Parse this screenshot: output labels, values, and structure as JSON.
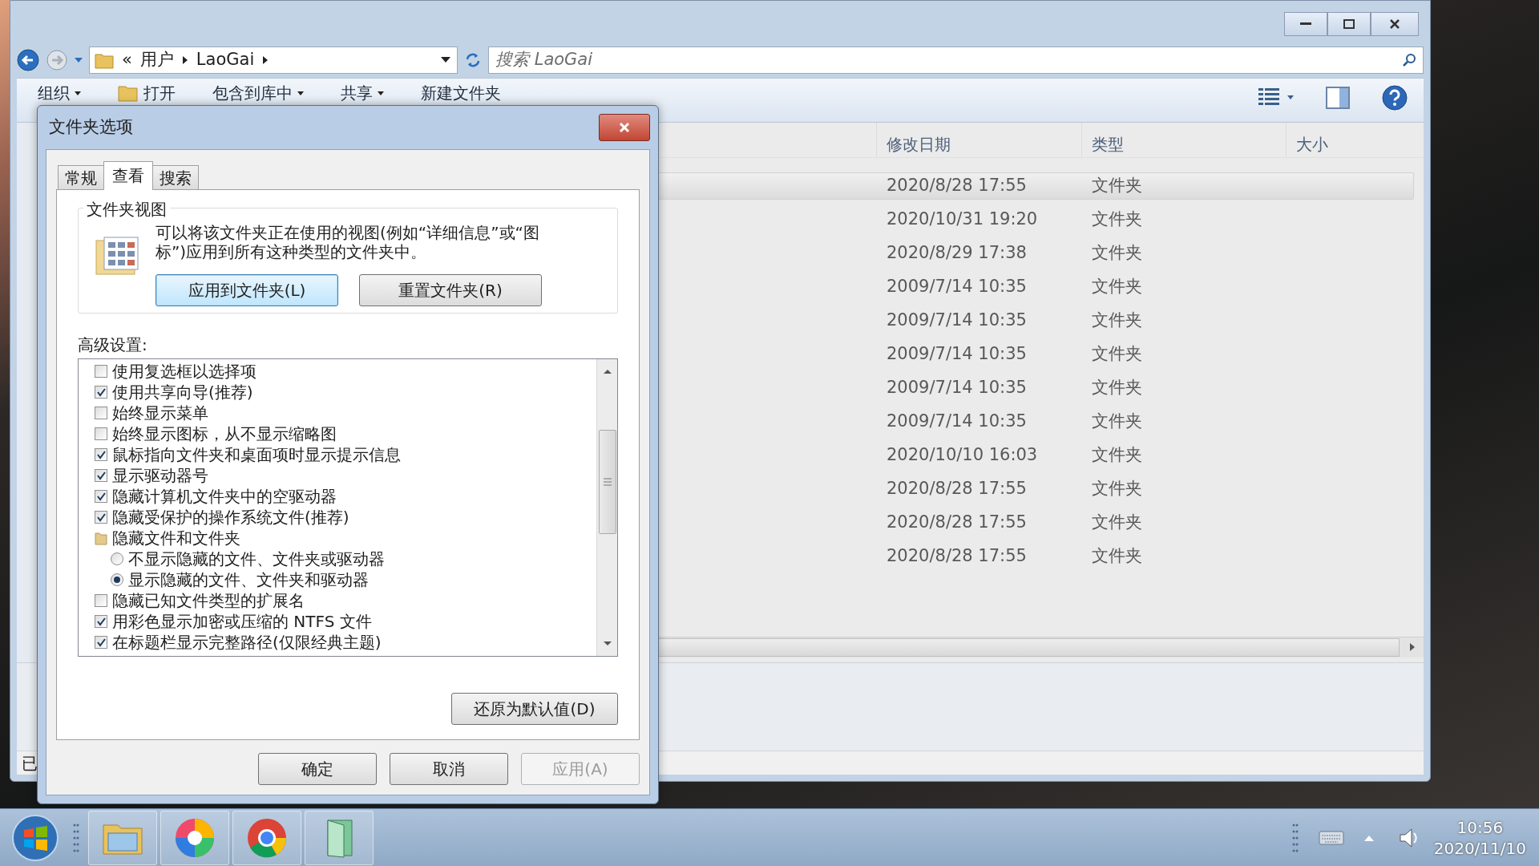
{
  "explorer": {
    "address": {
      "overflow_mark": "«",
      "path": [
        "用户",
        "LaoGai"
      ]
    },
    "search": {
      "placeholder": "搜索 LaoGai"
    },
    "toolbar": [
      {
        "label": "组织",
        "kind": "menu"
      },
      {
        "label": "打开",
        "kind": "open"
      },
      {
        "label": "包含到库中",
        "kind": "menu"
      },
      {
        "label": "共享",
        "kind": "menu"
      },
      {
        "label": "新建文件夹",
        "kind": "plain"
      }
    ],
    "columns": [
      "修改日期",
      "类型",
      "大小"
    ],
    "rows": [
      {
        "modified": "2020/8/28 17:55",
        "type": "文件夹",
        "selected": true
      },
      {
        "modified": "2020/10/31 19:20",
        "type": "文件夹",
        "selected": false
      },
      {
        "modified": "2020/8/29 17:38",
        "type": "文件夹",
        "selected": false
      },
      {
        "modified": "2009/7/14 10:35",
        "type": "文件夹",
        "selected": false
      },
      {
        "modified": "2009/7/14 10:35",
        "type": "文件夹",
        "selected": false
      },
      {
        "modified": "2009/7/14 10:35",
        "type": "文件夹",
        "selected": false
      },
      {
        "modified": "2009/7/14 10:35",
        "type": "文件夹",
        "selected": false
      },
      {
        "modified": "2009/7/14 10:35",
        "type": "文件夹",
        "selected": false
      },
      {
        "modified": "2020/10/10 16:03",
        "type": "文件夹",
        "selected": false
      },
      {
        "modified": "2020/8/28 17:55",
        "type": "文件夹",
        "selected": false
      },
      {
        "modified": "2020/8/28 17:55",
        "type": "文件夹",
        "selected": false
      },
      {
        "modified": "2020/8/28 17:55",
        "type": "文件夹",
        "selected": false
      }
    ],
    "status": "已"
  },
  "dialog": {
    "title": "文件夹选项",
    "tabs": [
      {
        "label": "常规",
        "selected": false
      },
      {
        "label": "查看",
        "selected": true
      },
      {
        "label": "搜索",
        "selected": false
      }
    ],
    "group_title": "文件夹视图",
    "description": "可以将该文件夹正在使用的视图(例如“详细信息”或“图标”)应用到所有这种类型的文件夹中。",
    "group_buttons": [
      {
        "label": "应用到文件夹(L)",
        "focused": true
      },
      {
        "label": "重置文件夹(R)",
        "focused": false
      }
    ],
    "advanced_label": "高级设置:",
    "advanced_items": [
      {
        "kind": "checkbox",
        "label": "使用复选框以选择项",
        "checked": false
      },
      {
        "kind": "checkbox",
        "label": "使用共享向导(推荐)",
        "checked": true
      },
      {
        "kind": "checkbox",
        "label": "始终显示菜单",
        "checked": false
      },
      {
        "kind": "checkbox",
        "label": "始终显示图标，从不显示缩略图",
        "checked": false
      },
      {
        "kind": "checkbox",
        "label": "鼠标指向文件夹和桌面项时显示提示信息",
        "checked": true
      },
      {
        "kind": "checkbox",
        "label": "显示驱动器号",
        "checked": true
      },
      {
        "kind": "checkbox",
        "label": "隐藏计算机文件夹中的空驱动器",
        "checked": true
      },
      {
        "kind": "checkbox",
        "label": "隐藏受保护的操作系统文件(推荐)",
        "checked": true
      },
      {
        "kind": "folder",
        "label": "隐藏文件和文件夹",
        "children": [
          {
            "kind": "radio",
            "label": "不显示隐藏的文件、文件夹或驱动器",
            "selected": false
          },
          {
            "kind": "radio",
            "label": "显示隐藏的文件、文件夹和驱动器",
            "selected": true
          }
        ]
      },
      {
        "kind": "checkbox",
        "label": "隐藏已知文件类型的扩展名",
        "checked": false
      },
      {
        "kind": "checkbox",
        "label": "用彩色显示加密或压缩的 NTFS 文件",
        "checked": true
      },
      {
        "kind": "checkbox",
        "label": "在标题栏显示完整路径(仅限经典主题)",
        "checked": true
      }
    ],
    "restore_button": "还原为默认值(D)",
    "buttons": [
      {
        "label": "确定",
        "disabled": false
      },
      {
        "label": "取消",
        "disabled": false
      },
      {
        "label": "应用(A)",
        "disabled": true
      }
    ]
  },
  "taskbar": {
    "apps": [
      {
        "kind": "explorer"
      },
      {
        "kind": "pinwheel"
      },
      {
        "kind": "chrome"
      },
      {
        "kind": "notebook"
      }
    ],
    "clock": {
      "time": "10:56",
      "date": "2020/11/10"
    }
  }
}
